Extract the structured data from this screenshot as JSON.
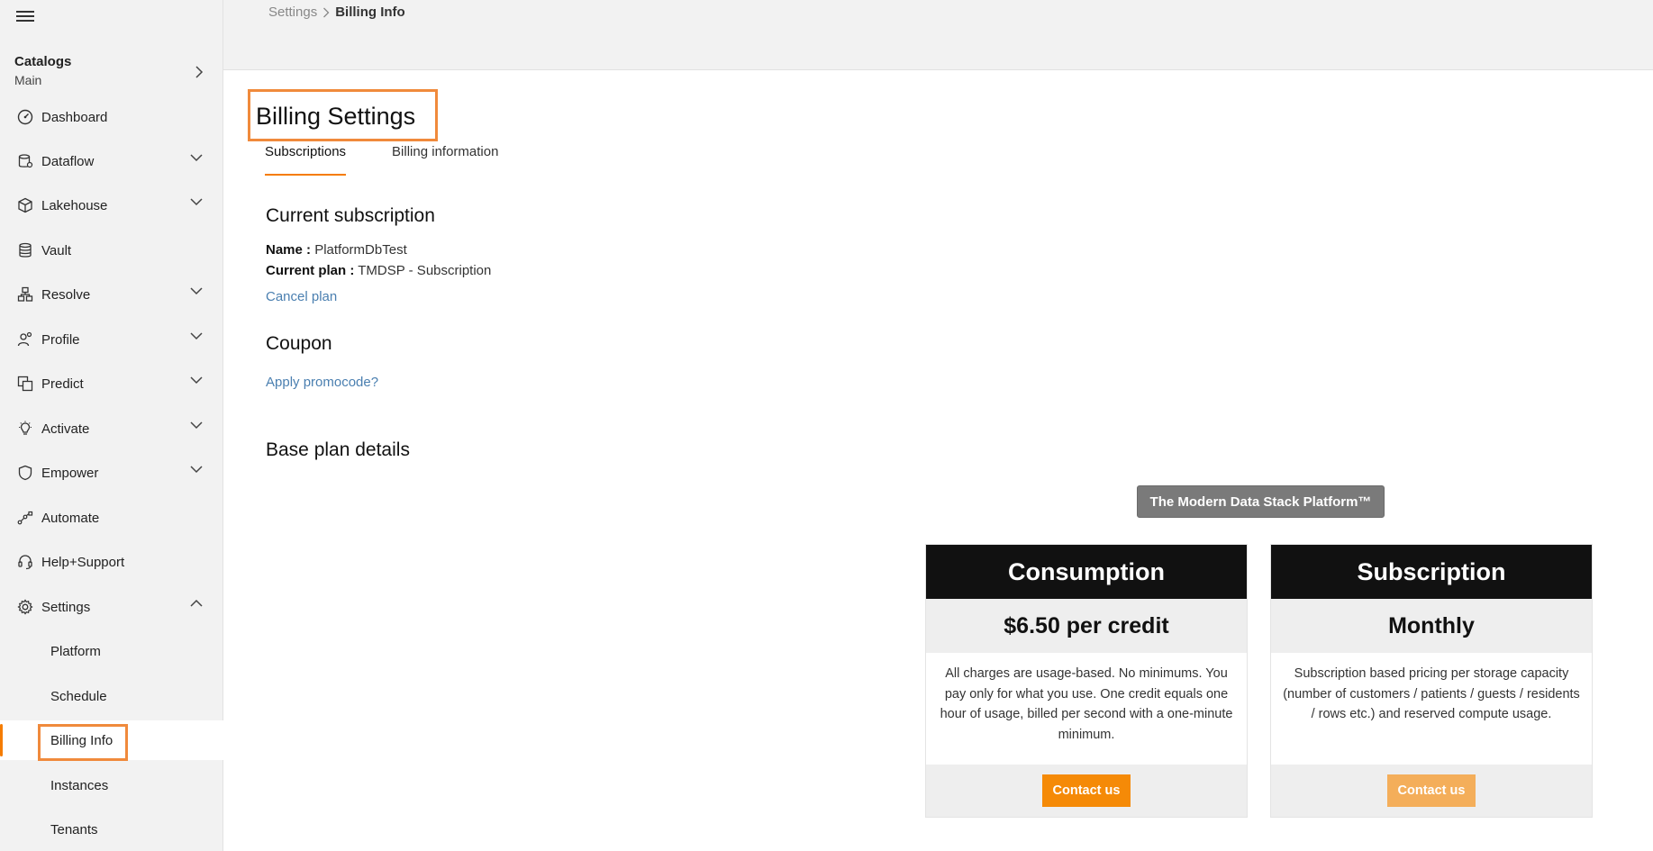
{
  "breadcrumb": {
    "parent": "Settings",
    "separator": ">",
    "current": "Billing Info"
  },
  "sidebar": {
    "catalogs": {
      "title": "Catalogs",
      "value": "Main"
    },
    "items": [
      {
        "label": "Dashboard",
        "icon": "dashboard-icon"
      },
      {
        "label": "Dataflow",
        "icon": "dataflow-icon"
      },
      {
        "label": "Lakehouse",
        "icon": "cube-icon"
      },
      {
        "label": "Vault",
        "icon": "database-icon"
      },
      {
        "label": "Resolve",
        "icon": "resolve-icon"
      },
      {
        "label": "Profile",
        "icon": "profile-icon"
      },
      {
        "label": "Predict",
        "icon": "predict-icon"
      },
      {
        "label": "Activate",
        "icon": "lightbulb-icon"
      },
      {
        "label": "Empower",
        "icon": "shield-icon"
      },
      {
        "label": "Automate",
        "icon": "automate-icon"
      },
      {
        "label": "Help+Support",
        "icon": "headset-icon"
      },
      {
        "label": "Settings",
        "icon": "gear-icon"
      }
    ],
    "settings_sub": [
      "Platform",
      "Schedule",
      "Billing Info",
      "Instances",
      "Tenants"
    ]
  },
  "page": {
    "title": "Billing Settings",
    "tabs": [
      "Subscriptions",
      "Billing information"
    ],
    "current_subscription": {
      "heading": "Current subscription",
      "name_label": "Name :",
      "name_value": "PlatformDbTest",
      "plan_label": "Current plan :",
      "plan_value": "TMDSP - Subscription",
      "cancel_link": "Cancel plan"
    },
    "coupon": {
      "heading": "Coupon",
      "link": "Apply promocode?"
    },
    "base_plan": {
      "heading": "Base plan details",
      "platform_label": "The Modern Data Stack Platform™"
    },
    "cards": [
      {
        "title": "Consumption",
        "price": "$6.50 per credit",
        "description": "All charges are usage-based. No minimums. You pay only for what you use. One credit equals one hour of usage, billed per second with a one-minute minimum.",
        "button": "Contact us"
      },
      {
        "title": "Subscription",
        "price": "Monthly",
        "description": "Subscription based pricing per storage capacity (number of customers / patients / guests / residents / rows etc.) and reserved compute usage.",
        "button": "Contact us"
      }
    ]
  },
  "colors": {
    "accent": "#f57c00",
    "highlight": "#f08a3c",
    "link": "#4a7fb0"
  }
}
